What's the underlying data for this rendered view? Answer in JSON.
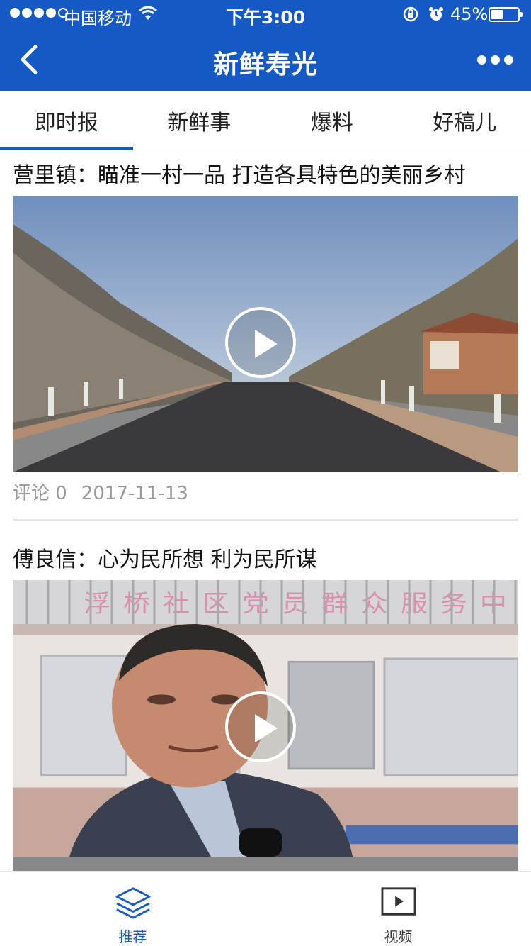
{
  "status_bar": {
    "carrier": "中国移动",
    "time": "下午3:00",
    "battery": "45%"
  },
  "header": {
    "title": "新鲜寿光"
  },
  "tabs": [
    {
      "label": "即时报",
      "active": true
    },
    {
      "label": "新鲜事",
      "active": false
    },
    {
      "label": "爆料",
      "active": false
    },
    {
      "label": "好稿儿",
      "active": false
    }
  ],
  "articles": [
    {
      "title": "营里镇：瞄准一村一品 打造各具特色的美丽乡村",
      "comments": "评论 0",
      "date": "2017-11-13"
    },
    {
      "title": "傅良信：心为民所想 利为民所谋",
      "sign_text": "浮桥社区党员群众服务中心"
    }
  ],
  "bottom_tabs": [
    {
      "label": "推荐",
      "icon": "layers-icon",
      "active": true
    },
    {
      "label": "视频",
      "icon": "video-play-icon",
      "active": false
    }
  ],
  "colors": {
    "brand": "#1659c4",
    "meta_text": "#999999"
  }
}
